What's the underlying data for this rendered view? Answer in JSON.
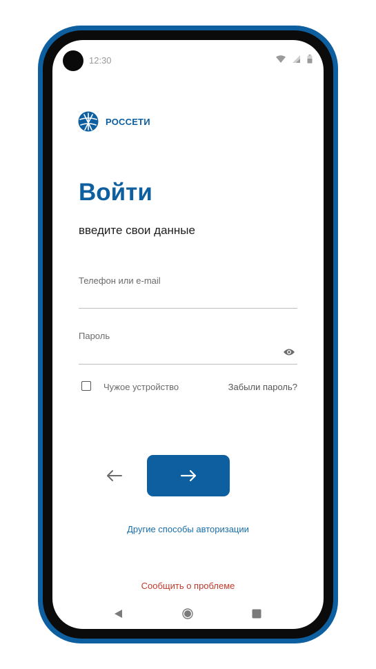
{
  "status_bar": {
    "time": "12:30",
    "icons": [
      "wifi-icon",
      "signal-icon",
      "battery-icon"
    ]
  },
  "brand": {
    "name": "РОССЕТИ",
    "logo_icon": "rosseti-logo-icon"
  },
  "login": {
    "title": "Войти",
    "subtitle": "введите свои данные",
    "login_label": "Телефон или e-mail",
    "login_value": "",
    "password_label": "Пароль",
    "password_value": "",
    "password_toggle_icon": "eye-icon",
    "foreign_device_label": "Чужое устройство",
    "foreign_device_checked": false,
    "forgot_password": "Забыли пароль?",
    "back_icon": "arrow-left-icon",
    "next_icon": "arrow-right-icon",
    "other_auth": "Другие способы авторизации",
    "report_problem": "Сообщить о проблеме"
  },
  "nav_bar": {
    "icons": [
      "nav-back-icon",
      "nav-home-icon",
      "nav-recent-icon"
    ]
  },
  "colors": {
    "brand": "#0d5fa0",
    "link": "#1a6ea8",
    "danger": "#c0392b",
    "frame": "#0b0b0c"
  }
}
